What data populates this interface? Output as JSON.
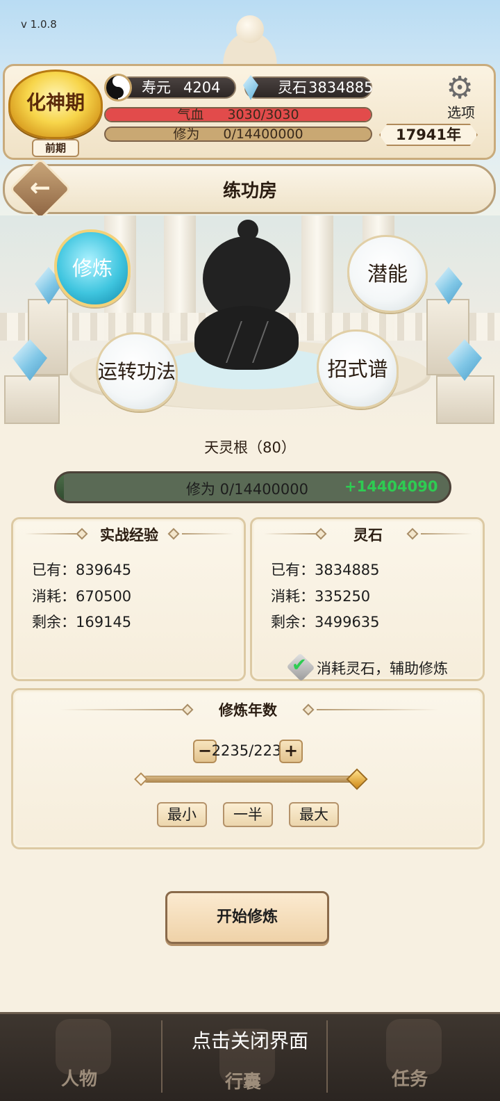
{
  "version": "v 1.0.8",
  "status": {
    "realm": "化神期",
    "stage": "前期",
    "lifespan_label": "寿元",
    "lifespan_value": "4204",
    "spirit_stone_label": "灵石",
    "spirit_stone_value": "3834885",
    "hp_label": "气血",
    "hp_value": "3030/3030",
    "hp_fraction": 1.0,
    "cultivation_label": "修为",
    "cultivation_value": "0/14400000",
    "cultivation_fraction": 0.0,
    "age": "17941年",
    "options_label": "选项"
  },
  "room": {
    "title": "练功房"
  },
  "actions": {
    "cultivate": "修炼",
    "potential": "潜能",
    "circulate": "运转功法",
    "techniques": "招式谱"
  },
  "spirit_root": "天灵根（80）",
  "xp": {
    "label": "修为 0/14400000",
    "bonus": "+14404090",
    "fraction": 0.0
  },
  "combat_exp": {
    "title": "实战经验",
    "owned": "已有：839645",
    "consumed": "消耗：670500",
    "remaining": "剩余：169145"
  },
  "stones": {
    "title": "灵石",
    "owned": "已有：3834885",
    "consumed": "消耗：335250",
    "remaining": "剩余：3499635",
    "auxiliary_label": "消耗灵石，辅助修炼",
    "auxiliary_checked": true
  },
  "years": {
    "title": "修炼年数",
    "minus": "−",
    "plus": "+",
    "value": "2235/223",
    "slider_fraction": 1.0,
    "min_label": "最小",
    "half_label": "一半",
    "max_label": "最大"
  },
  "start_label": "开始修炼",
  "bottom": {
    "close_hint": "点击关闭界面",
    "nav_character": "人物",
    "nav_bag": "行囊",
    "nav_tasks": "任务"
  },
  "colors": {
    "hp_fill": "#e24b4b",
    "cultivation_fill": "#c9a873",
    "xp_bonus": "#2ecc52",
    "active_bubble": "#3fc5df"
  },
  "icons": {
    "lifespan": "yin-yang-icon",
    "stone": "crystal-icon",
    "options": "gear-icon",
    "back": "arrow-left-icon",
    "check": "check-icon"
  }
}
